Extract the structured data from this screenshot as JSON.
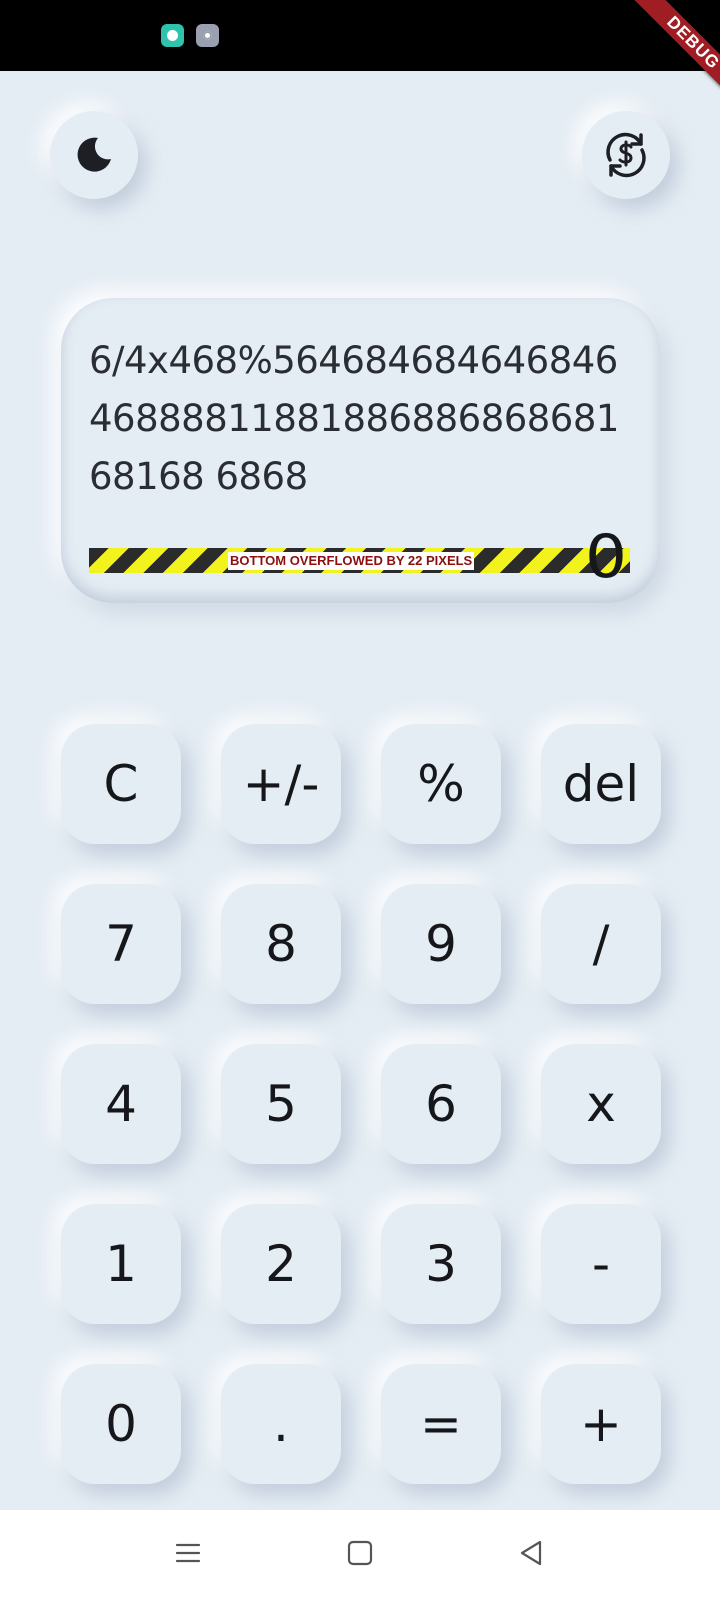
{
  "debug_banner": "DEBUG",
  "display": {
    "expression": "6/4x468%5646846846468464688881188188688686868168168 6868",
    "overflow_message": "BOTTOM OVERFLOWED BY 22 PIXELS",
    "result": "0"
  },
  "keypad": {
    "rows": [
      [
        "C",
        "+/-",
        "%",
        "del"
      ],
      [
        "7",
        "8",
        "9",
        "/"
      ],
      [
        "4",
        "5",
        "6",
        "x"
      ],
      [
        "1",
        "2",
        "3",
        "-"
      ],
      [
        "0",
        ".",
        "=",
        "+"
      ]
    ]
  },
  "icons": {
    "theme": "moon-icon",
    "currency": "currency-exchange-icon",
    "nav": [
      "menu-icon",
      "home-square-icon",
      "back-triangle-icon"
    ]
  },
  "colors": {
    "background": "#e5edf4",
    "status_bar": "#000000",
    "text": "#15171b",
    "debug_banner": "#a11d24",
    "overflow_yellow": "#f2f21c"
  }
}
